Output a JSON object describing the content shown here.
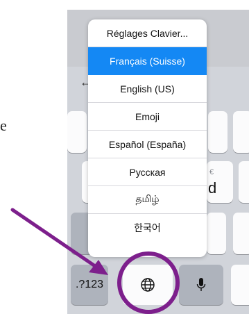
{
  "page": {
    "left_partial_text": "e"
  },
  "menu": {
    "items": [
      {
        "label": "Réglages Clavier..."
      },
      {
        "label": "Français (Suisse)",
        "selected": true
      },
      {
        "label": "English (US)"
      },
      {
        "label": "Emoji"
      },
      {
        "label": "Español (España)"
      },
      {
        "label": "Русская"
      },
      {
        "label": "தமிழ்"
      },
      {
        "label": "한국어"
      }
    ]
  },
  "keyboard": {
    "key_123_label": ".?123",
    "euro_label": "€",
    "letter_d": "d",
    "back_arrow": "←",
    "globe_icon": "globe-icon",
    "mic_icon": "microphone-icon"
  },
  "annotation": {
    "color": "#7d1f8c"
  },
  "colors": {
    "selection": "#1488f4",
    "keyboard_bg": "#d1d4da"
  }
}
